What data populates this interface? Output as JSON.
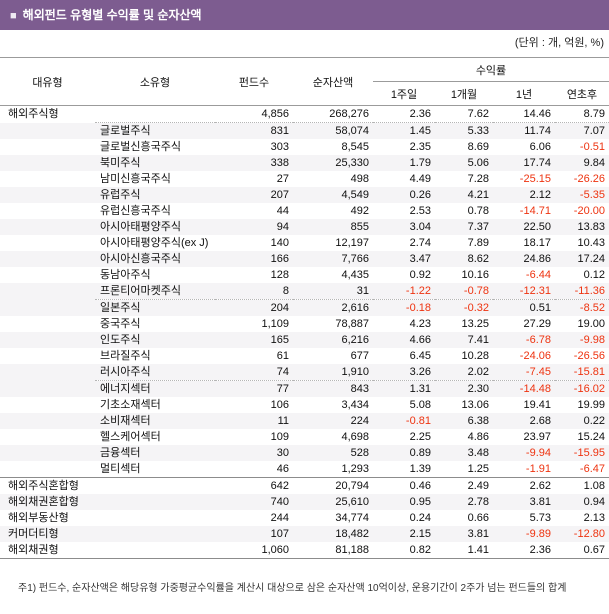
{
  "title_bar": {
    "bullet": "■",
    "title": "해외펀드 유형별 수익률 및 순자산액"
  },
  "unit_note": "(단위 : 개, 억원, %)",
  "table": {
    "headers": {
      "major_type": "대유형",
      "minor_type": "소유형",
      "fund_count": "펀드수",
      "net_assets": "순자산액",
      "returns_group": "수익률",
      "return_cols": [
        "1주일",
        "1개월",
        "1년",
        "연초후"
      ]
    },
    "rows": [
      {
        "major": "해외주식형",
        "minor": "",
        "count": "4,856",
        "assets": "268,276",
        "w1": "2.36",
        "m1": "7.62",
        "y1": "14.46",
        "ytd": "8.79",
        "shaded": false,
        "sep": "dotted"
      },
      {
        "major": "",
        "minor": "글로벌주식",
        "count": "831",
        "assets": "58,074",
        "w1": "1.45",
        "m1": "5.33",
        "y1": "11.74",
        "ytd": "7.07",
        "shaded": true,
        "sep": ""
      },
      {
        "major": "",
        "minor": "글로벌신흥국주식",
        "count": "303",
        "assets": "8,545",
        "w1": "2.35",
        "m1": "8.69",
        "y1": "6.06",
        "ytd": "-0.51",
        "shaded": false,
        "sep": ""
      },
      {
        "major": "",
        "minor": "북미주식",
        "count": "338",
        "assets": "25,330",
        "w1": "1.79",
        "m1": "5.06",
        "y1": "17.74",
        "ytd": "9.84",
        "shaded": true,
        "sep": ""
      },
      {
        "major": "",
        "minor": "남미신흥국주식",
        "count": "27",
        "assets": "498",
        "w1": "4.49",
        "m1": "7.28",
        "y1": "-25.15",
        "ytd": "-26.26",
        "shaded": false,
        "sep": ""
      },
      {
        "major": "",
        "minor": "유럽주식",
        "count": "207",
        "assets": "4,549",
        "w1": "0.26",
        "m1": "4.21",
        "y1": "2.12",
        "ytd": "-5.35",
        "shaded": true,
        "sep": ""
      },
      {
        "major": "",
        "minor": "유럽신흥국주식",
        "count": "44",
        "assets": "492",
        "w1": "2.53",
        "m1": "0.78",
        "y1": "-14.71",
        "ytd": "-20.00",
        "shaded": false,
        "sep": ""
      },
      {
        "major": "",
        "minor": "아시아태평양주식",
        "count": "94",
        "assets": "855",
        "w1": "3.04",
        "m1": "7.37",
        "y1": "22.50",
        "ytd": "13.83",
        "shaded": true,
        "sep": ""
      },
      {
        "major": "",
        "minor": "아시아태평양주식(ex J)",
        "count": "140",
        "assets": "12,197",
        "w1": "2.74",
        "m1": "7.89",
        "y1": "18.17",
        "ytd": "10.43",
        "shaded": false,
        "sep": ""
      },
      {
        "major": "",
        "minor": "아시아신흥국주식",
        "count": "166",
        "assets": "7,766",
        "w1": "3.47",
        "m1": "8.62",
        "y1": "24.86",
        "ytd": "17.24",
        "shaded": true,
        "sep": ""
      },
      {
        "major": "",
        "minor": "동남아주식",
        "count": "128",
        "assets": "4,435",
        "w1": "0.92",
        "m1": "10.16",
        "y1": "-6.44",
        "ytd": "0.12",
        "shaded": false,
        "sep": ""
      },
      {
        "major": "",
        "minor": "프론티어마켓주식",
        "count": "8",
        "assets": "31",
        "w1": "-1.22",
        "m1": "-0.78",
        "y1": "-12.31",
        "ytd": "-11.36",
        "shaded": true,
        "sep": "dotted"
      },
      {
        "major": "",
        "minor": "일본주식",
        "count": "204",
        "assets": "2,616",
        "w1": "-0.18",
        "m1": "-0.32",
        "y1": "0.51",
        "ytd": "-8.52",
        "shaded": true,
        "sep": ""
      },
      {
        "major": "",
        "minor": "중국주식",
        "count": "1,109",
        "assets": "78,887",
        "w1": "4.23",
        "m1": "13.25",
        "y1": "27.29",
        "ytd": "19.00",
        "shaded": false,
        "sep": ""
      },
      {
        "major": "",
        "minor": "인도주식",
        "count": "165",
        "assets": "6,216",
        "w1": "4.66",
        "m1": "7.41",
        "y1": "-6.78",
        "ytd": "-9.98",
        "shaded": true,
        "sep": ""
      },
      {
        "major": "",
        "minor": "브라질주식",
        "count": "61",
        "assets": "677",
        "w1": "6.45",
        "m1": "10.28",
        "y1": "-24.06",
        "ytd": "-26.56",
        "shaded": false,
        "sep": ""
      },
      {
        "major": "",
        "minor": "러시아주식",
        "count": "74",
        "assets": "1,910",
        "w1": "3.26",
        "m1": "2.02",
        "y1": "-7.45",
        "ytd": "-15.81",
        "shaded": true,
        "sep": "dotted"
      },
      {
        "major": "",
        "minor": "에너지섹터",
        "count": "77",
        "assets": "843",
        "w1": "1.31",
        "m1": "2.30",
        "y1": "-14.48",
        "ytd": "-16.02",
        "shaded": true,
        "sep": ""
      },
      {
        "major": "",
        "minor": "기초소재섹터",
        "count": "106",
        "assets": "3,434",
        "w1": "5.08",
        "m1": "13.06",
        "y1": "19.41",
        "ytd": "19.99",
        "shaded": false,
        "sep": ""
      },
      {
        "major": "",
        "minor": "소비재섹터",
        "count": "11",
        "assets": "224",
        "w1": "-0.81",
        "m1": "6.38",
        "y1": "2.68",
        "ytd": "0.22",
        "shaded": true,
        "sep": ""
      },
      {
        "major": "",
        "minor": "헬스케어섹터",
        "count": "109",
        "assets": "4,698",
        "w1": "2.25",
        "m1": "4.86",
        "y1": "23.97",
        "ytd": "15.24",
        "shaded": false,
        "sep": ""
      },
      {
        "major": "",
        "minor": "금융섹터",
        "count": "30",
        "assets": "528",
        "w1": "0.89",
        "m1": "3.48",
        "y1": "-9.94",
        "ytd": "-15.95",
        "shaded": true,
        "sep": ""
      },
      {
        "major": "",
        "minor": "멀티섹터",
        "count": "46",
        "assets": "1,293",
        "w1": "1.39",
        "m1": "1.25",
        "y1": "-1.91",
        "ytd": "-6.47",
        "shaded": false,
        "sep": "solid"
      },
      {
        "major": "해외주식혼합형",
        "minor": "",
        "count": "642",
        "assets": "20,794",
        "w1": "0.46",
        "m1": "2.49",
        "y1": "2.62",
        "ytd": "1.08",
        "shaded": false,
        "sep": ""
      },
      {
        "major": "해외채권혼합형",
        "minor": "",
        "count": "740",
        "assets": "25,610",
        "w1": "0.95",
        "m1": "2.78",
        "y1": "3.81",
        "ytd": "0.94",
        "shaded": true,
        "sep": ""
      },
      {
        "major": "해외부동산형",
        "minor": "",
        "count": "244",
        "assets": "34,774",
        "w1": "0.24",
        "m1": "0.66",
        "y1": "5.73",
        "ytd": "2.13",
        "shaded": false,
        "sep": ""
      },
      {
        "major": "커머더티형",
        "minor": "",
        "count": "107",
        "assets": "18,482",
        "w1": "2.15",
        "m1": "3.81",
        "y1": "-9.89",
        "ytd": "-12.80",
        "shaded": true,
        "sep": ""
      },
      {
        "major": "해외채권형",
        "minor": "",
        "count": "1,060",
        "assets": "81,188",
        "w1": "0.82",
        "m1": "1.41",
        "y1": "2.36",
        "ytd": "0.67",
        "shaded": false,
        "sep": "solid"
      }
    ]
  },
  "footnote": "주1) 펀드수, 순자산액은 해당유형 가중평균수익률을 계산시 대상으로 삼은 순자산액 10억이상, 운용기간이 2주가 넘는 펀드들의 합계",
  "colors": {
    "accent_purple": "#7d5c90",
    "negative_red": "#ee3310",
    "row_stripe": "#f5f4f6",
    "line_gray": "#9b9b9b"
  }
}
